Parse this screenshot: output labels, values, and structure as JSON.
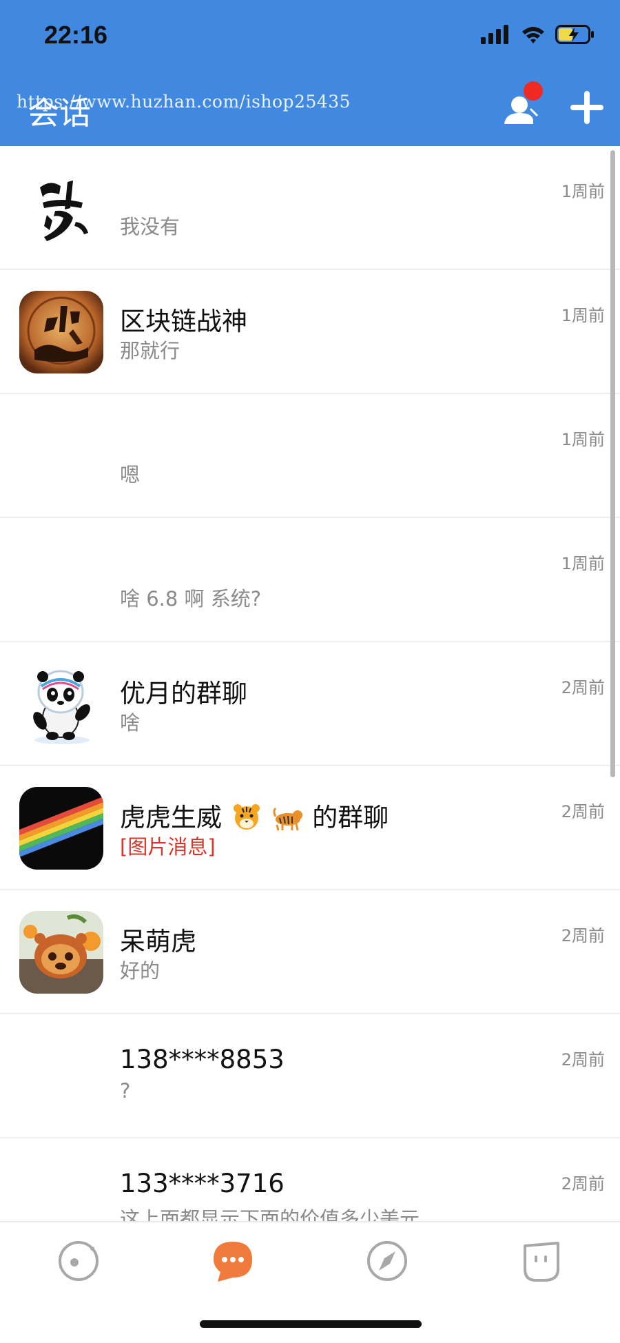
{
  "status_bar": {
    "time": "22:16"
  },
  "header": {
    "title": "会话",
    "watermark": "https://www.huzhan.com/ishop25435"
  },
  "conversations": [
    {
      "name": "",
      "message": "我没有",
      "time": "1周前",
      "avatar": "calligraphy-avatar"
    },
    {
      "name": "区块链战神",
      "message": "那就行",
      "time": "1周前",
      "avatar": "war-god-avatar"
    },
    {
      "name": "",
      "message": "嗯",
      "time": "1周前",
      "avatar": ""
    },
    {
      "name": "",
      "message": "啥 6.8 啊 系统?",
      "time": "1周前",
      "avatar": ""
    },
    {
      "name": "优月的群聊",
      "message": "啥",
      "time": "2周前",
      "avatar": "panda-mascot-avatar"
    },
    {
      "name_prefix": "虎虎生威",
      "name_suffix": "的群聊",
      "name_emojis": [
        "tiger-face-emoji",
        "tiger-emoji"
      ],
      "message": "[图片消息]",
      "time": "2周前",
      "avatar": "rainbow-stripe-avatar"
    },
    {
      "name": "呆萌虎",
      "message": "好的",
      "time": "2周前",
      "avatar": "tiger-toy-avatar"
    },
    {
      "name": "138****8853",
      "message": "?",
      "time": "2周前",
      "avatar": ""
    },
    {
      "name": "133****3716",
      "message": "这上面都显示下面的价值多少美元",
      "time": "2周前",
      "avatar": ""
    }
  ],
  "tabs": [
    {
      "name": "discover",
      "icon": "planet-icon",
      "active": false
    },
    {
      "name": "messages",
      "icon": "chat-bubble-icon",
      "active": true
    },
    {
      "name": "explore",
      "icon": "compass-icon",
      "active": false
    },
    {
      "name": "profile",
      "icon": "face-icon",
      "active": false
    }
  ],
  "colors": {
    "header": "#4189e0",
    "badge": "#ee2a22",
    "active_tab": "#f07a3c",
    "inactive_tab": "#a8a8a8",
    "red_message": "#d8352a"
  }
}
